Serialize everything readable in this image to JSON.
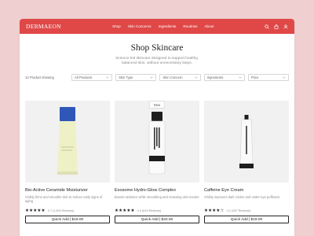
{
  "header": {
    "logo": "DERMAEON",
    "nav": [
      "Shop",
      "Skin Concerns",
      "Ingredients",
      "Routines",
      "About"
    ]
  },
  "hero": {
    "title": "Shop Skincare",
    "subtitle": "Science-led skincare designed to support healthy, balanced skin, without unnecessary steps."
  },
  "filters": {
    "count_text": "12 Product showing",
    "options": [
      "All Products",
      "Skin Type",
      "Skin Concern",
      "Ingredients",
      "Price"
    ]
  },
  "products": [
    {
      "name": "Bio-Active Ceramide Moisturizer",
      "description": "Visibly firms and smooths skin to reduce early signs of aging",
      "rating_text": "4.7 (1,834 Reviews)",
      "stars": "★★★★★",
      "button": "Quick Add | $19.00",
      "badge": ""
    },
    {
      "name": "Exosome Hydro-Glow Complex",
      "description": "Boosts radiance while smoothing and renewing skin texture",
      "rating_text": "4.9 (615 Reviews)",
      "stars": "★★★★★",
      "button": "Quick Add | $20.00",
      "badge": "New"
    },
    {
      "name": "Caffeine Eye Cream",
      "description": "Visibly improves dark circles and under-eye puffiness",
      "rating_text": "4.1 (287 Reviews)",
      "stars": "★★★★☆",
      "button": "Quick Add | $19.00",
      "badge": ""
    }
  ],
  "colors": {
    "brand": "#e04848",
    "background": "#f0cfd1"
  },
  "icons": [
    "search-icon",
    "bag-icon",
    "user-icon",
    "chevron-down-icon"
  ]
}
